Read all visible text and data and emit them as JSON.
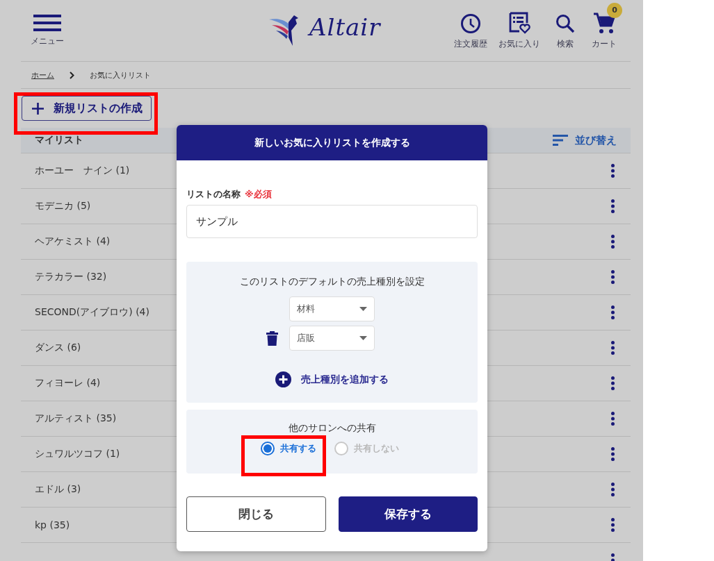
{
  "header": {
    "menu_label": "メニュー",
    "logo_text": "Altair",
    "actions": [
      {
        "kind": "history",
        "label": "注文履歴"
      },
      {
        "kind": "favorites",
        "label": "お気に入り"
      },
      {
        "kind": "search",
        "label": "検索"
      },
      {
        "kind": "cart",
        "label": "カート",
        "badge": "0"
      }
    ]
  },
  "breadcrumb": [
    {
      "label": "ホーム",
      "link": true
    },
    {
      "label": "お気に入りリスト",
      "link": false
    }
  ],
  "new_list_button": {
    "label": "新規リストの作成",
    "highlighted": true
  },
  "list": {
    "title": "マイリスト",
    "sort_label": "並び替え",
    "items": [
      {
        "label": "ホーユー　ナイン (1)"
      },
      {
        "label": "モデニカ (5)"
      },
      {
        "label": "ヘアケミスト (4)"
      },
      {
        "label": "テラカラー (32)"
      },
      {
        "label": "SECOND(アイブロウ) (4)"
      },
      {
        "label": "ダンス (6)"
      },
      {
        "label": "フィヨーレ (4)"
      },
      {
        "label": "アルティスト (35)"
      },
      {
        "label": "シュワルツコフ (1)"
      },
      {
        "label": "エドル (3)"
      },
      {
        "label": "kp (35)"
      },
      {
        "more_menu": true
      }
    ]
  },
  "dialog": {
    "title": "新しいお気に入りリストを作成する",
    "name_field": {
      "label": "リストの名称",
      "required": "※必須",
      "value": "サンプル"
    },
    "sales_type": {
      "title": "このリストのデフォルトの売上種別を設定",
      "selects": [
        {
          "value": "材料",
          "deletable": false
        },
        {
          "value": "店販",
          "deletable": true
        }
      ],
      "add_label": "売上種別を追加する"
    },
    "sharing": {
      "title": "他のサロンへの共有",
      "highlighted": true,
      "options": [
        {
          "label": "共有する",
          "selected": true
        },
        {
          "label": "共有しない",
          "selected": false
        }
      ]
    },
    "close_button": "閉じる",
    "save_button": "保存する"
  }
}
